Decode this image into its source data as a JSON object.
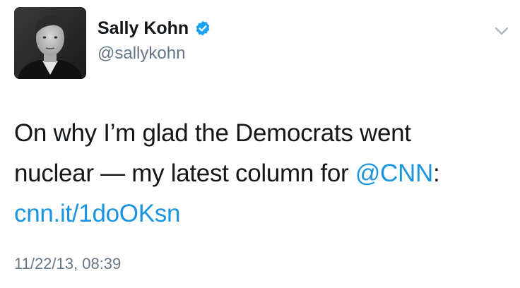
{
  "tweet": {
    "author": {
      "display_name": "Sally Kohn",
      "handle": "@sallykohn",
      "verified": true,
      "avatar_icon": "profile-photo"
    },
    "text_line1": "On why I’m glad the Democrats went",
    "text_line2_prefix": "nuclear — my latest column for ",
    "mention": "@CNN",
    "text_line2_suffix": ":",
    "link": "cnn.it/1doOKsn",
    "timestamp": "11/22/13, 08:39",
    "menu_icon": "chevron-down-icon"
  },
  "colors": {
    "text": "#14171a",
    "secondary": "#657786",
    "link": "#1b95e0",
    "verified_badge": "#1da1f2"
  }
}
